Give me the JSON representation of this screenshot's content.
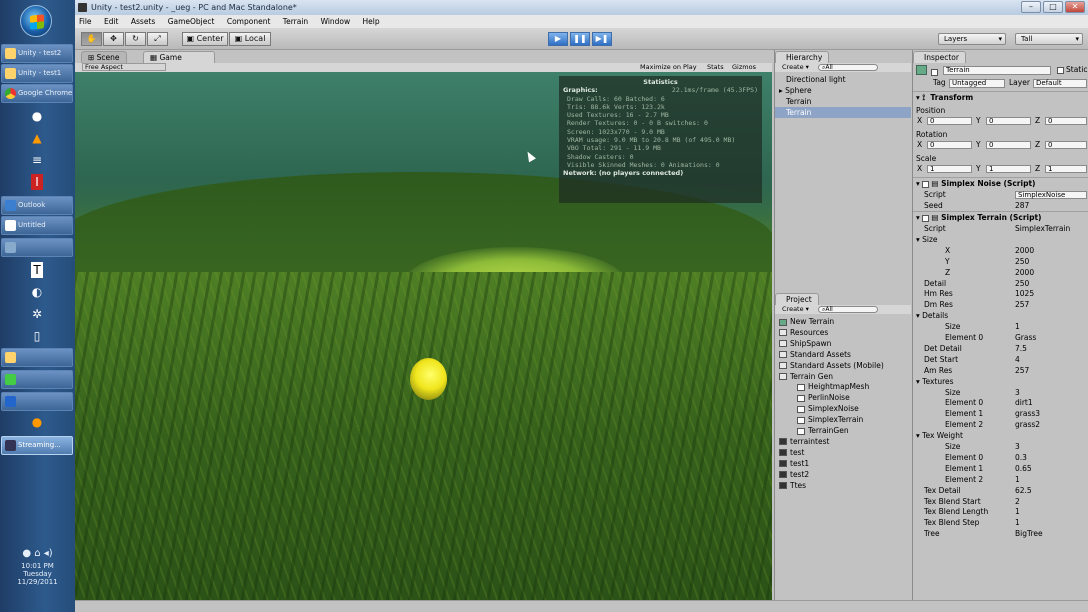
{
  "window": {
    "title": "Unity - test2.unity - _ueg - PC and Mac Standalone*"
  },
  "menu": [
    "File",
    "Edit",
    "Assets",
    "GameObject",
    "Component",
    "Terrain",
    "Window",
    "Help"
  ],
  "toolbar": {
    "center_label": "Center",
    "local_label": "Local",
    "layers_label": "Layers",
    "layout_label": "Tall"
  },
  "scene_tab": "Scene",
  "game_tab": "Game",
  "game_bar": {
    "aspect": "Free Aspect",
    "maximize": "Maximize on Play",
    "stats": "Stats",
    "gizmos": "Gizmos"
  },
  "stats": {
    "title": "Statistics",
    "graphics_label": "Graphics:",
    "fps": "22.1ms/frame (45.3FPS)",
    "lines": [
      "Draw Calls: 60    Batched: 6",
      "Tris: 88.6k    Verts: 123.2k",
      "Used Textures: 16 - 2.7 MB",
      "Render Textures: 0 - 0 B    switches: 0",
      "Screen: 1023x770 - 9.0 MB",
      "VRAM usage: 9.0 MB to 20.8 MB (of 495.0 MB)",
      "VBO Total: 291 - 11.9 MB",
      "Shadow Casters: 0",
      "Visible Skinned Meshes: 0    Animations: 0"
    ],
    "network": "Network: (no players connected)"
  },
  "hierarchy": {
    "title": "Hierarchy",
    "create": "Create",
    "search": "All",
    "items": [
      "Directional light",
      "Sphere",
      "Terrain",
      "Terrain"
    ]
  },
  "project": {
    "title": "Project",
    "create": "Create",
    "search": "All",
    "items": [
      {
        "label": "New Terrain",
        "kind": "terrain"
      },
      {
        "label": "Resources",
        "kind": "folder"
      },
      {
        "label": "ShipSpawn",
        "kind": "folder"
      },
      {
        "label": "Standard Assets",
        "kind": "folder"
      },
      {
        "label": "Standard Assets (Mobile)",
        "kind": "folder"
      },
      {
        "label": "Terrain Gen",
        "kind": "folder"
      },
      {
        "label": "HeightmapMesh",
        "kind": "script"
      },
      {
        "label": "PerlinNoise",
        "kind": "script"
      },
      {
        "label": "SimplexNoise",
        "kind": "script"
      },
      {
        "label": "SimplexTerrain",
        "kind": "script"
      },
      {
        "label": "TerrainGen",
        "kind": "script"
      },
      {
        "label": "terraintest",
        "kind": "scene"
      },
      {
        "label": "test",
        "kind": "scene"
      },
      {
        "label": "test1",
        "kind": "scene"
      },
      {
        "label": "test2",
        "kind": "scene"
      },
      {
        "label": "Ttes",
        "kind": "scene"
      }
    ]
  },
  "inspector": {
    "title": "Inspector",
    "object_name": "Terrain",
    "static": "Static",
    "tag_label": "Tag",
    "tag": "Untagged",
    "layer_label": "Layer",
    "layer": "Default",
    "transform": {
      "title": "Transform",
      "position": "Position",
      "rotation": "Rotation",
      "scale": "Scale",
      "pos": [
        "0",
        "0",
        "0"
      ],
      "rot": [
        "0",
        "0",
        "0"
      ],
      "scl": [
        "1",
        "1",
        "1"
      ]
    },
    "noise": {
      "title": "Simplex Noise (Script)",
      "script_label": "Script",
      "script": "SimplexNoise",
      "seed_label": "Seed",
      "seed": "287"
    },
    "terrain": {
      "title": "Simplex Terrain (Script)",
      "rows": [
        {
          "label": "Script",
          "value": "SimplexTerrain",
          "indent": 0
        },
        {
          "label": "Size",
          "value": "",
          "indent": 0,
          "fold": true
        },
        {
          "label": "X",
          "value": "2000",
          "indent": 1
        },
        {
          "label": "Y",
          "value": "250",
          "indent": 1
        },
        {
          "label": "Z",
          "value": "2000",
          "indent": 1
        },
        {
          "label": "Detail",
          "value": "250",
          "indent": 0
        },
        {
          "label": "Hm Res",
          "value": "1025",
          "indent": 0
        },
        {
          "label": "Dm Res",
          "value": "257",
          "indent": 0
        },
        {
          "label": "Details",
          "value": "",
          "indent": 0,
          "fold": true
        },
        {
          "label": "Size",
          "value": "1",
          "indent": 1
        },
        {
          "label": "Element 0",
          "value": "Grass",
          "indent": 1
        },
        {
          "label": "Det Detail",
          "value": "7.5",
          "indent": 0
        },
        {
          "label": "Det Start",
          "value": "4",
          "indent": 0
        },
        {
          "label": "Am Res",
          "value": "257",
          "indent": 0
        },
        {
          "label": "Textures",
          "value": "",
          "indent": 0,
          "fold": true
        },
        {
          "label": "Size",
          "value": "3",
          "indent": 1
        },
        {
          "label": "Element 0",
          "value": "dirt1",
          "indent": 1
        },
        {
          "label": "Element 1",
          "value": "grass3",
          "indent": 1
        },
        {
          "label": "Element 2",
          "value": "grass2",
          "indent": 1
        },
        {
          "label": "Tex Weight",
          "value": "",
          "indent": 0,
          "fold": true
        },
        {
          "label": "Size",
          "value": "3",
          "indent": 1
        },
        {
          "label": "Element 0",
          "value": "0.3",
          "indent": 1
        },
        {
          "label": "Element 1",
          "value": "0.65",
          "indent": 1
        },
        {
          "label": "Element 2",
          "value": "1",
          "indent": 1
        },
        {
          "label": "Tex Detail",
          "value": "62.5",
          "indent": 0
        },
        {
          "label": "Tex Blend Start",
          "value": "2",
          "indent": 0
        },
        {
          "label": "Tex Blend Length",
          "value": "1",
          "indent": 0
        },
        {
          "label": "Tex Blend Step",
          "value": "1",
          "indent": 0
        },
        {
          "label": "Tree",
          "value": "BigTree",
          "indent": 0
        }
      ]
    }
  },
  "taskbar": {
    "buttons": [
      "Unity - test2",
      "Unity - test1",
      "Google Chrome",
      "Outlook",
      "Untitled",
      "Streaming..."
    ],
    "clock": {
      "time": "10:01 PM",
      "day": "Tuesday",
      "date": "11/29/2011"
    }
  }
}
